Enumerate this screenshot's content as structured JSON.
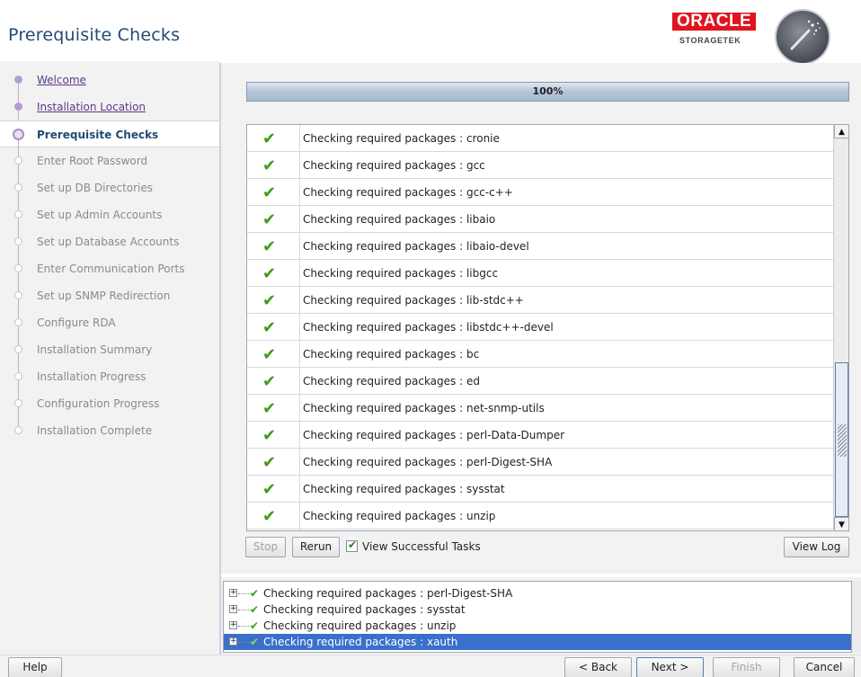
{
  "window": {
    "title": "Prerequisite Checks"
  },
  "brand": {
    "oracle": "ORACLE",
    "storagetek": "STORAGETEK"
  },
  "nav": {
    "items": [
      {
        "label": "Welcome",
        "state": "done"
      },
      {
        "label": "Installation Location",
        "state": "done"
      },
      {
        "label": "Prerequisite Checks",
        "state": "current"
      },
      {
        "label": "Enter Root Password",
        "state": "todo"
      },
      {
        "label": "Set up DB Directories",
        "state": "todo"
      },
      {
        "label": "Set up Admin Accounts",
        "state": "todo"
      },
      {
        "label": "Set up Database Accounts",
        "state": "todo"
      },
      {
        "label": "Enter Communication Ports",
        "state": "todo"
      },
      {
        "label": "Set up SNMP Redirection",
        "state": "todo"
      },
      {
        "label": "Configure RDA",
        "state": "todo"
      },
      {
        "label": "Installation Summary",
        "state": "todo"
      },
      {
        "label": "Installation Progress",
        "state": "todo"
      },
      {
        "label": "Configuration Progress",
        "state": "todo"
      },
      {
        "label": "Installation Complete",
        "state": "todo"
      }
    ]
  },
  "progress": {
    "value": 1.0,
    "label": "100%"
  },
  "checks": {
    "rows": [
      "Checking required packages : cronie",
      "Checking required packages : gcc",
      "Checking required packages : gcc-c++",
      "Checking required packages : libaio",
      "Checking required packages : libaio-devel",
      "Checking required packages : libgcc",
      "Checking required packages : lib-stdc++",
      "Checking required packages : libstdc++-devel",
      "Checking required packages : bc",
      "Checking required packages : ed",
      "Checking required packages : net-snmp-utils",
      "Checking required packages : perl-Data-Dumper",
      "Checking required packages : perl-Digest-SHA",
      "Checking required packages : sysstat",
      "Checking required packages : unzip",
      "Checking required packages : xauth"
    ],
    "status_icon": "green-checkmark"
  },
  "controls": {
    "stop": "Stop",
    "rerun": "Rerun",
    "view_successful": "View Successful Tasks",
    "view_successful_checked": true,
    "view_log": "View Log"
  },
  "log": {
    "rows": [
      {
        "text": "Checking required packages : perl-Digest-SHA",
        "selected": false
      },
      {
        "text": "Checking required packages : sysstat",
        "selected": false
      },
      {
        "text": "Checking required packages : unzip",
        "selected": false
      },
      {
        "text": "Checking required packages : xauth",
        "selected": true
      }
    ]
  },
  "footer": {
    "help": "Help",
    "back": "< Back",
    "next": "Next >",
    "finish": "Finish",
    "cancel": "Cancel"
  },
  "colors": {
    "title": "#234a73",
    "accent_purple": "#5b3a8c",
    "check_green": "#3f9c16",
    "selection_blue": "#3a6fcb",
    "oracle_red": "#e0141e"
  }
}
